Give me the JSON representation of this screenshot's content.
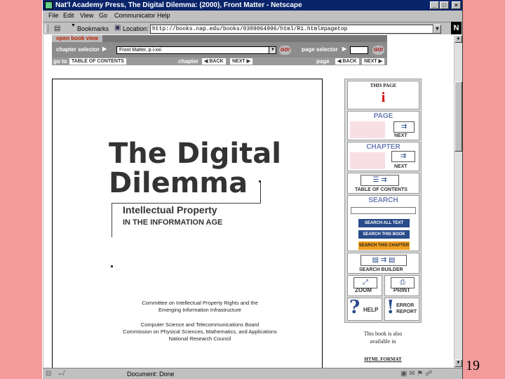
{
  "window": {
    "title": "Nat'l Academy Press, The Digital Dilemma: (2000), Front Matter - Netscape",
    "buttons": {
      "minimize": "_",
      "maximize": "□",
      "close": "×"
    }
  },
  "menu": [
    "File",
    "Edit",
    "View",
    "Go",
    "Communicator",
    "Help"
  ],
  "toolbar": {
    "bookmarks_label": "Bookmarks",
    "location_label": "Location:",
    "url": "http://books.nap.edu/books/0309064996/html/R1.html#pagetop"
  },
  "nav": {
    "open_book_view": "open book view",
    "chapter_selector_label": "chapter selector",
    "chapter_selector_value": "Front Matter, p.i-xxi",
    "go_label": "GO!",
    "page_selector_label": "page selector",
    "go_to_label": "go to",
    "toc_label": "TABLE OF CONTENTS",
    "chapter_label": "chapter",
    "page_label": "page",
    "back_label": "BACK",
    "next_label": "NEXT"
  },
  "book_page": {
    "title_line1": "The Digital",
    "title_line2": "Dilemma",
    "subtitle1": "Intellectual Property",
    "subtitle2": "IN THE INFORMATION AGE",
    "credits1": [
      "Committee on Intellectual Property Rights and the",
      "Emerging Information Infrastructure"
    ],
    "credits2": [
      "Computer Science and Telecommunications Board",
      "Commission on Physical Sciences, Mathematics, and Applications",
      "National Research Council"
    ]
  },
  "sidebar": {
    "this_page_label": "THIS PAGE",
    "this_page_value": "i",
    "page_label": "PAGE",
    "page_next": "NEXT",
    "chapter_label": "CHAPTER",
    "chapter_next": "NEXT",
    "toc_label": "TABLE OF CONTENTS",
    "search_label": "SEARCH",
    "search_all": "SEARCH ALL TEXT",
    "search_book": "SEARCH THIS BOOK",
    "search_chapter": "SEARCH THIS CHAPTER",
    "search_builder": "SEARCH BUILDER",
    "zoom": "ZOOM",
    "print": "PRINT",
    "help": "HELP",
    "error_report_1": "ERROR",
    "error_report_2": "REPORT",
    "also_available_1": "This book is also",
    "also_available_2": "available in",
    "html_format": "HTML FORMAT"
  },
  "status": {
    "text": "Document: Done"
  },
  "slide_number": "19",
  "colors": {
    "slide_bg": "#f39b9b",
    "title_bar": "#0a246a",
    "nav_gray": "#8c8c8c",
    "sidebar_blue": "#2a4b8a",
    "search_chapter_orange": "#f0a020"
  }
}
